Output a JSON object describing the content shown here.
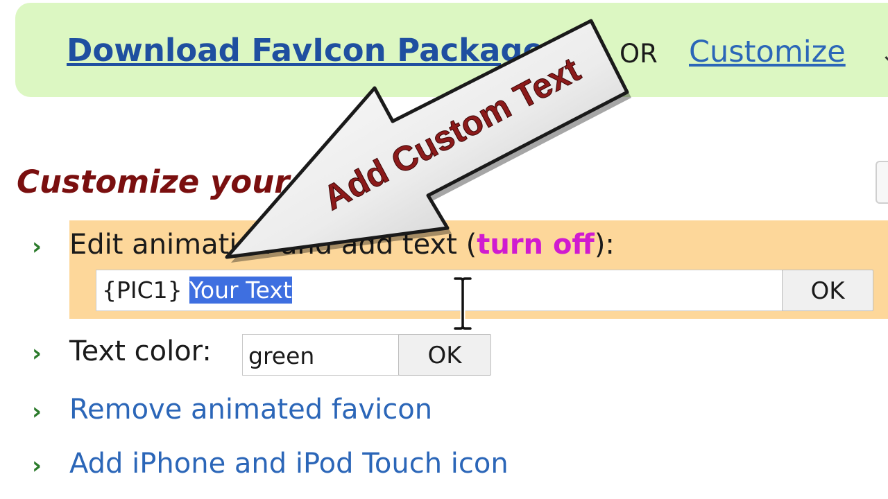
{
  "download_bar": {
    "download_link": "Download FavIcon Package",
    "or_label": "OR",
    "customize_link": "Customize",
    "edge_glyph": "↓"
  },
  "section": {
    "heading": "Customize your favicon:"
  },
  "edit_animation": {
    "label": "Edit animation and add text (",
    "turn_off": "turn off",
    "label_end": "):",
    "input_prefix": "{PIC1} ",
    "input_selected": "Your Text",
    "ok_label": "OK"
  },
  "text_color": {
    "label": "Text color:",
    "value": "green",
    "ok_label": "OK"
  },
  "links": {
    "remove_animated": "Remove animated favicon",
    "add_iphone": "Add iPhone and iPod Touch icon"
  },
  "callout": {
    "text": "Add Custom Text"
  },
  "icons": {
    "chevron": "›"
  },
  "colors": {
    "download_bar_bg": "#dcf7c2",
    "highlight_row_bg": "#fdd79a",
    "heading_color": "#7a0f0f",
    "link_color": "#2b66b8",
    "turn_off_color": "#d01bd0",
    "selection_color": "#3e6fe0",
    "callout_text_color": "#8b1a1a"
  }
}
